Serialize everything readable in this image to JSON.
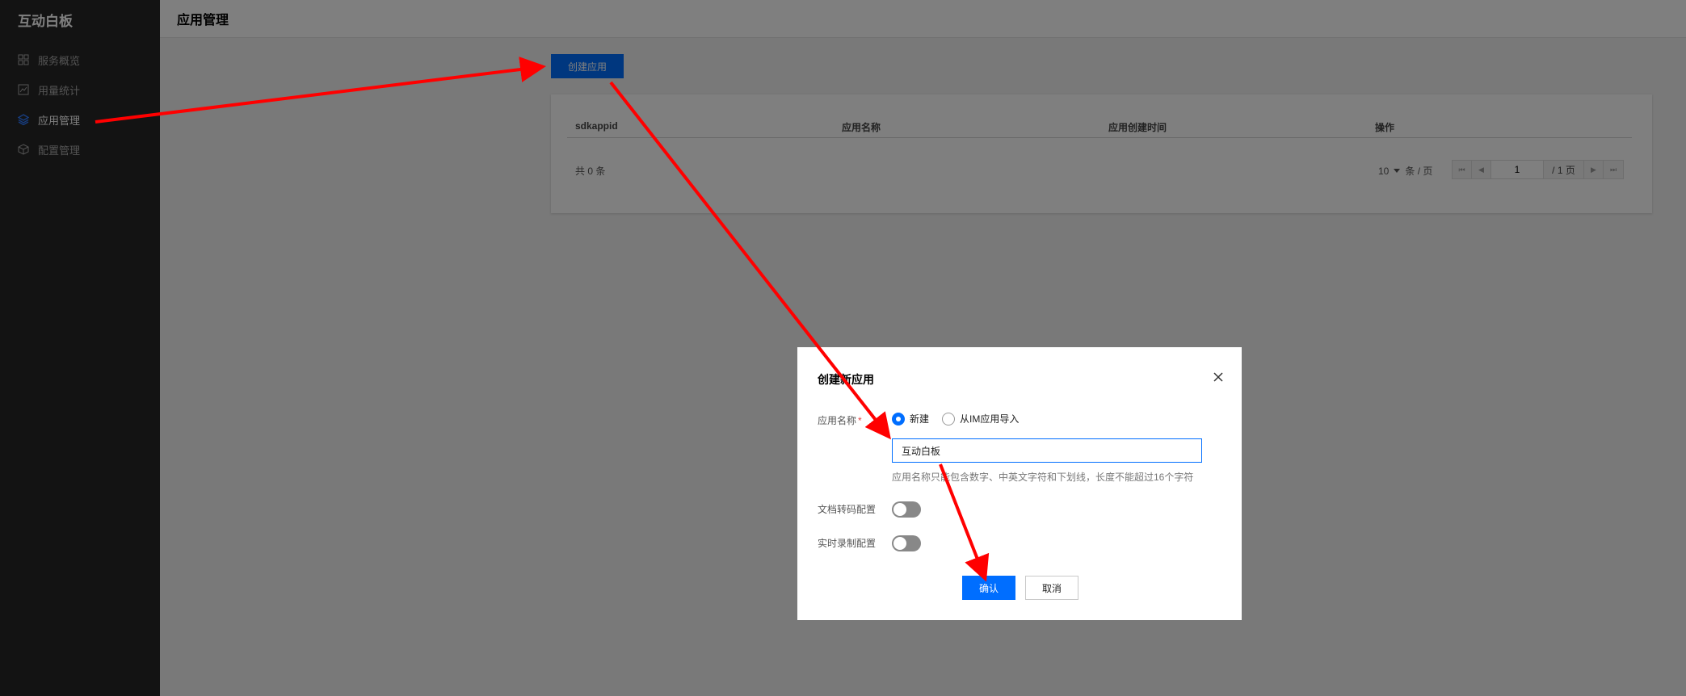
{
  "sidebar": {
    "brand": "互动白板",
    "items": [
      {
        "label": "服务概览",
        "icon": "grid-icon",
        "active": false
      },
      {
        "label": "用量统计",
        "icon": "chart-icon",
        "active": false
      },
      {
        "label": "应用管理",
        "icon": "layers-icon",
        "active": true
      },
      {
        "label": "配置管理",
        "icon": "cube-icon",
        "active": false
      }
    ]
  },
  "header": {
    "title": "应用管理"
  },
  "toolbar": {
    "create_label": "创建应用"
  },
  "table": {
    "columns": [
      "sdkappid",
      "应用名称",
      "应用创建时间",
      "操作"
    ],
    "rows": [],
    "total_text": "共 0 条",
    "page_size": "10",
    "page_size_unit": "条 / 页",
    "current_page": "1",
    "page_total": "/ 1 页"
  },
  "modal": {
    "title": "创建新应用",
    "name_label": "应用名称",
    "required_mark": "*",
    "radio_new": "新建",
    "radio_import": "从IM应用导入",
    "name_value": "互动白板",
    "hint": "应用名称只能包含数字、中英文字符和下划线，长度不能超过16个字符",
    "doc_label": "文档转码配置",
    "record_label": "实时录制配置",
    "ok_label": "确认",
    "cancel_label": "取消"
  },
  "colors": {
    "accent": "#006eff",
    "sidebar_bg": "#262626",
    "annotation_arrow": "#ff0000"
  }
}
